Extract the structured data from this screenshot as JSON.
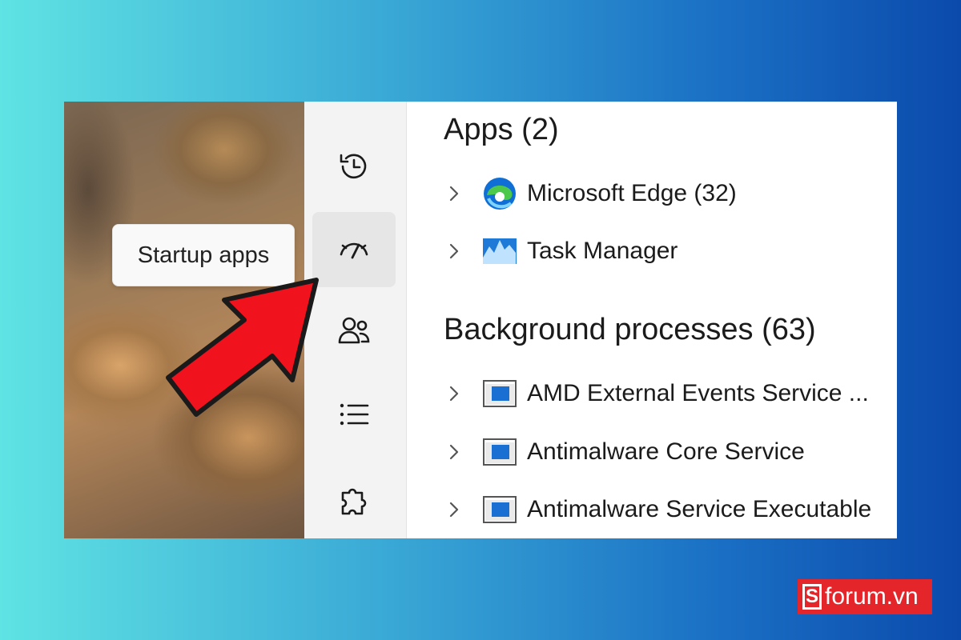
{
  "tooltip": {
    "text": "Startup apps"
  },
  "sidebar": {
    "items": [
      {
        "name": "app-history",
        "icon": "history-icon"
      },
      {
        "name": "startup-apps",
        "icon": "speedometer-icon",
        "active": true
      },
      {
        "name": "users",
        "icon": "users-icon"
      },
      {
        "name": "details",
        "icon": "list-icon"
      },
      {
        "name": "services",
        "icon": "puzzle-icon"
      }
    ]
  },
  "content": {
    "apps_title": "Apps (2)",
    "apps": [
      {
        "label": "Microsoft Edge (32)",
        "icon": "edge-icon"
      },
      {
        "label": "Task Manager",
        "icon": "task-manager-icon"
      }
    ],
    "bg_title": "Background processes (63)",
    "background": [
      {
        "label": "AMD External Events Service ...",
        "icon": "service-window-icon"
      },
      {
        "label": "Antimalware Core Service",
        "icon": "service-window-icon"
      },
      {
        "label": "Antimalware Service Executable",
        "icon": "service-window-icon"
      }
    ]
  },
  "logo": {
    "mark": "S",
    "text": "forum.vn"
  },
  "colors": {
    "arrow": "#f0131e",
    "logo_bg": "#e4262b",
    "edge_blue": "#0f6fd6",
    "edge_green": "#4cc84a"
  }
}
